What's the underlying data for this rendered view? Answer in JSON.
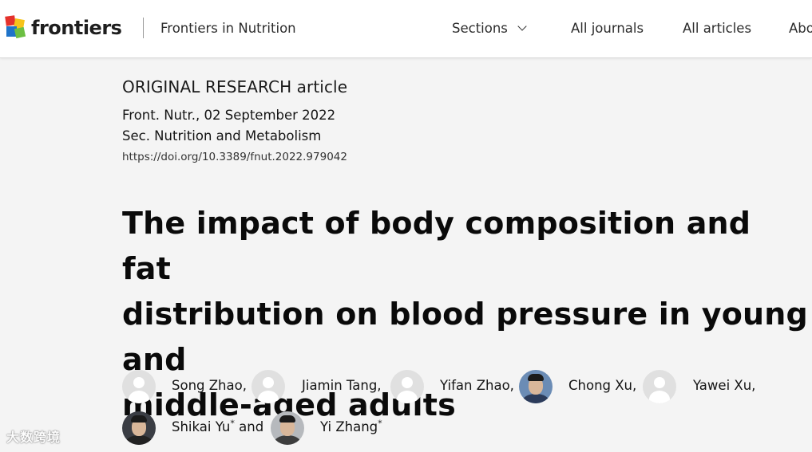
{
  "header": {
    "logo_text": "frontiers",
    "journal": "Frontiers in Nutrition",
    "nav": {
      "sections": "Sections",
      "all_journals": "All journals",
      "all_articles": "All articles",
      "about_partial": "Abo"
    }
  },
  "article": {
    "type": "ORIGINAL RESEARCH article",
    "date_line": "Front. Nutr., 02 September 2022",
    "section_line": "Sec. Nutrition and Metabolism",
    "doi": "https://doi.org/10.3389/fnut.2022.979042",
    "title_lines": [
      "The impact of body composition and fat",
      "distribution on blood pressure in young and",
      "middle-aged adults"
    ]
  },
  "authors": [
    {
      "name": "Song Zhao,",
      "mark": ""
    },
    {
      "name": "Jiamin Tang,",
      "mark": ""
    },
    {
      "name": "Yifan Zhao,",
      "mark": ""
    },
    {
      "name": "Chong Xu,",
      "mark": ""
    },
    {
      "name": "Yawei Xu,",
      "mark": ""
    },
    {
      "name": "Shikai Yu",
      "mark": "*",
      "suffix": " and"
    },
    {
      "name": "Yi Zhang",
      "mark": "*"
    }
  ],
  "watermark": "大数跨境",
  "colors": {
    "header_bg": "#ffffff",
    "page_bg": "#f4f4f4",
    "text": "#0c0c0c",
    "logo_red": "#e4312b",
    "logo_blue": "#1f73c9",
    "logo_green": "#6cbf42",
    "logo_yellow": "#f6c31a"
  }
}
